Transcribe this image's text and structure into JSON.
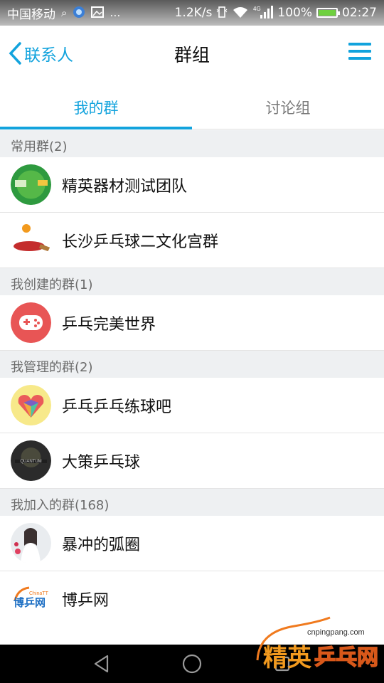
{
  "status_bar": {
    "carrier": "中国移动",
    "speed": "1.2K/s",
    "network": "4G",
    "battery": "100%",
    "battery_level": 1.0,
    "time": "02:27"
  },
  "header": {
    "back_label": "联系人",
    "title": "群组"
  },
  "tabs": [
    {
      "label": "我的群",
      "active": true
    },
    {
      "label": "讨论组",
      "active": false
    }
  ],
  "sections": [
    {
      "header": "常用群(2)",
      "groups": [
        {
          "name": "精英器材测试团队"
        },
        {
          "name": "长沙乒乓球二文化宫群"
        }
      ]
    },
    {
      "header": "我创建的群(1)",
      "groups": [
        {
          "name": "乒乓完美世界"
        }
      ]
    },
    {
      "header": "我管理的群(2)",
      "groups": [
        {
          "name": "乒乓乒乓练球吧"
        },
        {
          "name": "大策乒乓球"
        }
      ]
    },
    {
      "header": "我加入的群(168)",
      "groups": [
        {
          "name": "暴冲的弧圈"
        },
        {
          "name": "博乒网"
        }
      ]
    }
  ],
  "avatar_texts": {
    "quantum": "QUANTUM",
    "chinatt": "ChinaTT",
    "bopingwang": "博乒网"
  },
  "watermark": {
    "url": "cnpingpang.com",
    "text_a": "精英",
    "text_b": "乒乓网"
  },
  "colors": {
    "accent": "#12a3dd",
    "section_bg": "#eef0f2"
  }
}
